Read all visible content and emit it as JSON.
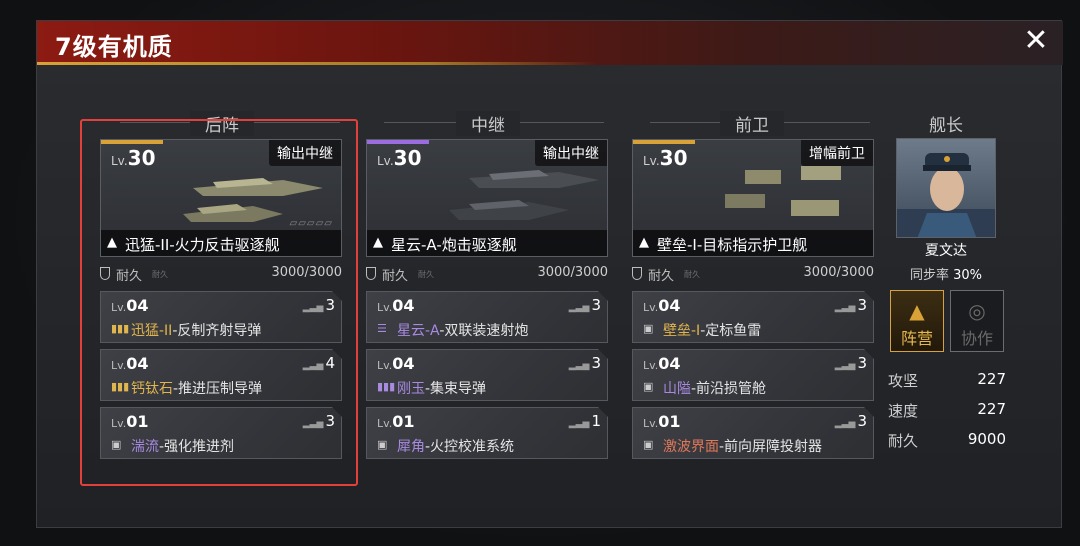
{
  "title": "7级有机质",
  "close_icon": "close-icon",
  "columns": [
    {
      "header": "后阵",
      "ship": {
        "lv_prefix": "Lv.",
        "level": "30",
        "role": "输出中继",
        "name": "迅猛-II-火力反击驱逐舰",
        "rarity_color": "#d8a237"
      },
      "durability": {
        "label": "耐久",
        "sub": "耐久",
        "value": "3000/3000"
      },
      "equipment": [
        {
          "lv_prefix": "Lv.",
          "level": "04",
          "stars": "3",
          "highlight": "迅猛-II",
          "rest": "-反制齐射导弹",
          "hl": "hl"
        },
        {
          "lv_prefix": "Lv.",
          "level": "04",
          "stars": "4",
          "highlight": "钙钛石",
          "rest": "-推进压制导弹",
          "hl": "hl"
        },
        {
          "lv_prefix": "Lv.",
          "level": "01",
          "stars": "3",
          "highlight": "湍流",
          "rest": "-强化推进剂",
          "hl": "hlp"
        }
      ]
    },
    {
      "header": "中继",
      "ship": {
        "lv_prefix": "Lv.",
        "level": "30",
        "role": "输出中继",
        "name": "星云-A-炮击驱逐舰",
        "rarity_color": "#9b6be0"
      },
      "durability": {
        "label": "耐久",
        "sub": "耐久",
        "value": "3000/3000"
      },
      "equipment": [
        {
          "lv_prefix": "Lv.",
          "level": "04",
          "stars": "3",
          "highlight": "星云-A",
          "rest": "-双联装速射炮",
          "hl": "hlp"
        },
        {
          "lv_prefix": "Lv.",
          "level": "04",
          "stars": "3",
          "highlight": "刚玉",
          "rest": "-集束导弹",
          "hl": "hlp"
        },
        {
          "lv_prefix": "Lv.",
          "level": "01",
          "stars": "1",
          "highlight": "犀角",
          "rest": "-火控校准系统",
          "hl": "hlp"
        }
      ]
    },
    {
      "header": "前卫",
      "ship": {
        "lv_prefix": "Lv.",
        "level": "30",
        "role": "增幅前卫",
        "name": "壁垒-I-目标指示护卫舰",
        "rarity_color": "#d8a237"
      },
      "durability": {
        "label": "耐久",
        "sub": "耐久",
        "value": "3000/3000"
      },
      "equipment": [
        {
          "lv_prefix": "Lv.",
          "level": "04",
          "stars": "3",
          "highlight": "壁垒-I",
          "rest": "-定标鱼雷",
          "hl": "hl"
        },
        {
          "lv_prefix": "Lv.",
          "level": "04",
          "stars": "3",
          "highlight": "山隘",
          "rest": "-前沿损管舱",
          "hl": "hlp"
        },
        {
          "lv_prefix": "Lv.",
          "level": "01",
          "stars": "3",
          "highlight": "激波界面",
          "rest": "-前向屏障投射器",
          "hl": "hlr"
        }
      ]
    }
  ],
  "captain": {
    "header": "舰长",
    "name": "夏文达",
    "sync_label": "同步率",
    "sync_value": "30%",
    "buttons": [
      {
        "label": "阵营",
        "icon": "faction-icon",
        "active": true
      },
      {
        "label": "协作",
        "icon": "cooperation-icon",
        "active": false
      }
    ],
    "stats": [
      {
        "label": "攻坚",
        "value": "227"
      },
      {
        "label": "速度",
        "value": "227"
      },
      {
        "label": "耐久",
        "value": "9000"
      }
    ]
  }
}
